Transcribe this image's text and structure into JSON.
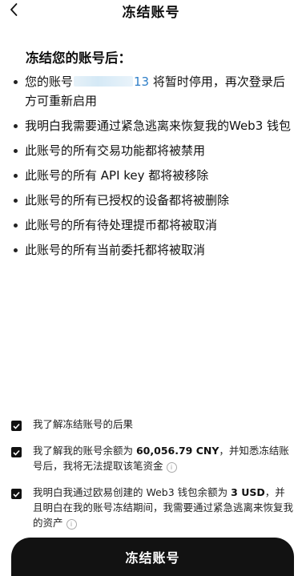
{
  "header": {
    "title": "冻结账号",
    "back_icon": "chevron-left-icon"
  },
  "subheading": "冻结您的账号后：",
  "consequences": [
    {
      "prefix": "您的账号",
      "masked_value": "",
      "account_tail": "13",
      "suffix": "将暂时停用，再次登录后方可重新启用"
    },
    {
      "text": "我明白我需要通过紧急逃离来恢复我的Web3 钱包"
    },
    {
      "text": "此账号的所有交易功能都将被禁用"
    },
    {
      "text": "此账号的所有 API key 都将被移除"
    },
    {
      "text": "此账号的所有已授权的设备都将被删除"
    },
    {
      "text": "此账号的所有待处理提币都将被取消"
    },
    {
      "text": "此账号的所有当前委托都将被取消"
    }
  ],
  "acknowledgements": [
    {
      "checked": true,
      "text_before": "我了解冻结账号的后果",
      "bold": "",
      "text_after": "",
      "info_icon": false
    },
    {
      "checked": true,
      "text_before": "我了解我的账号余额为 ",
      "bold": "60,056.79 CNY",
      "text_after": "，并知悉冻结账号后，我将无法提取该笔资金",
      "info_icon": true
    },
    {
      "checked": true,
      "text_before": "我明白我通过欧易创建的 Web3 钱包余额为 ",
      "bold": "3 USD",
      "text_after": "，并且明白在我的账号冻结期间，我需要通过紧急逃离来恢复我的资产",
      "info_icon": true
    }
  ],
  "info_icon_glyph": "i",
  "freeze_button": {
    "label": "冻结账号"
  },
  "colors": {
    "accent_link": "#2f7fc8",
    "button_bg": "#121212",
    "checkbox": "#111111"
  }
}
